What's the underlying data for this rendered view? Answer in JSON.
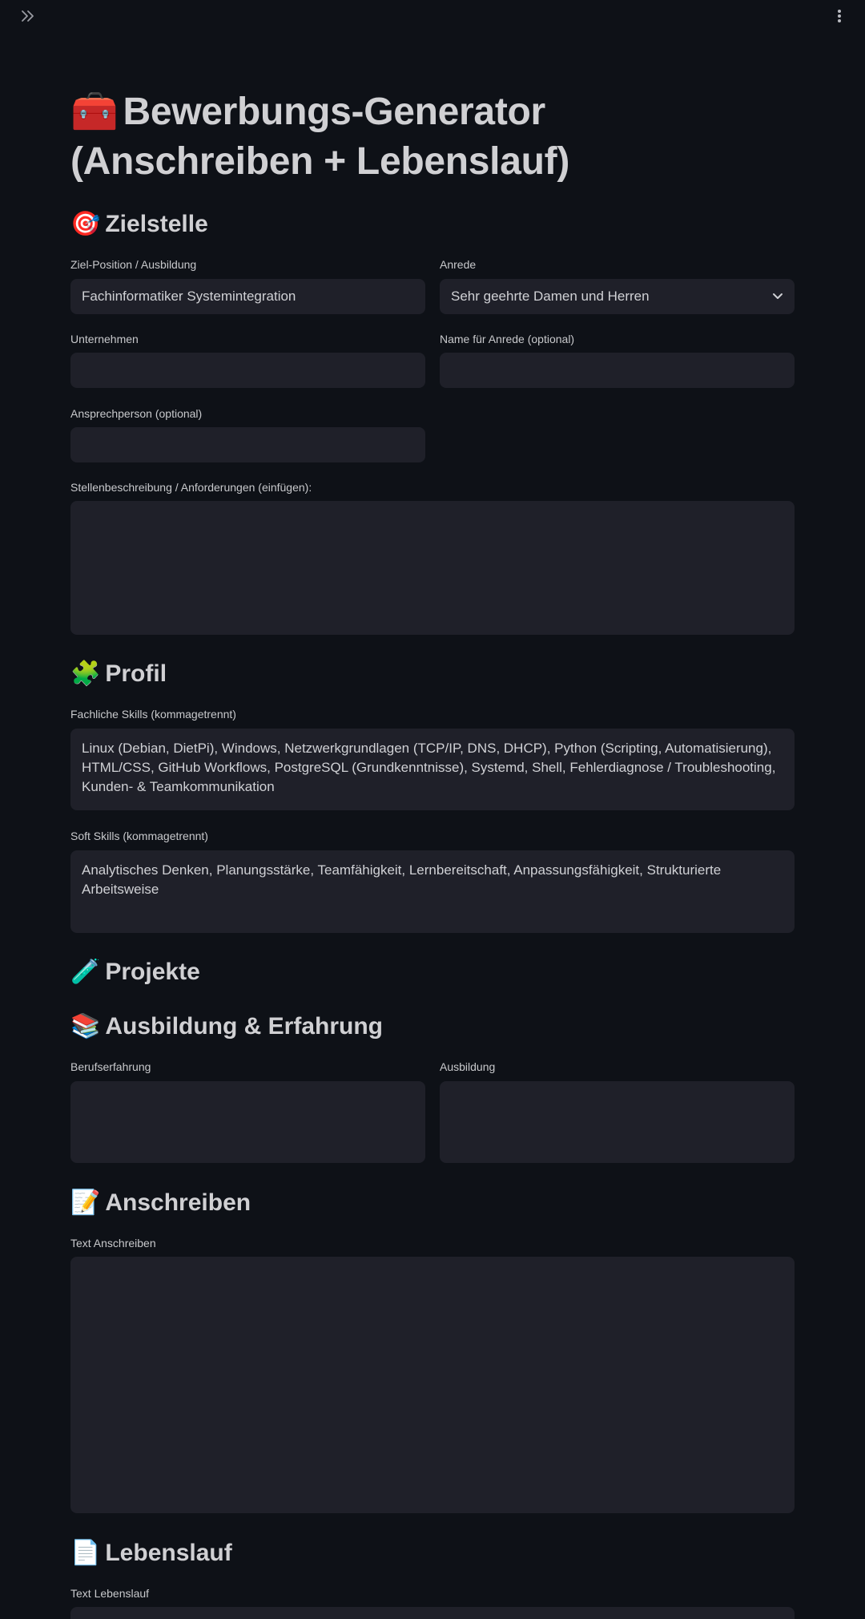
{
  "header": {
    "expand_icon": "double-chevron-right-icon",
    "menu_icon": "vertical-dots-icon"
  },
  "title": {
    "emoji": "🧰",
    "text": "Bewerbungs-Generator (Anschreiben + Lebenslauf)"
  },
  "sections": {
    "zielstelle": {
      "emoji": "🎯",
      "label": "Zielstelle"
    },
    "profil": {
      "emoji": "🧩",
      "label": "Profil"
    },
    "projekte": {
      "emoji": "🧪",
      "label": "Projekte"
    },
    "ausbildung": {
      "emoji": "📚",
      "label": "Ausbildung & Erfahrung"
    },
    "anschreiben": {
      "emoji": "📝",
      "label": "Anschreiben"
    },
    "lebenslauf": {
      "emoji": "📄",
      "label": "Lebenslauf"
    }
  },
  "fields": {
    "position": {
      "label": "Ziel-Position / Ausbildung",
      "value": "Fachinformatiker Systemintegration"
    },
    "anrede": {
      "label": "Anrede",
      "value": "Sehr geehrte Damen und Herren"
    },
    "unternehmen": {
      "label": "Unternehmen",
      "value": ""
    },
    "anrede_name": {
      "label": "Name für Anrede (optional)",
      "value": ""
    },
    "ansprechperson": {
      "label": "Ansprechperson (optional)",
      "value": ""
    },
    "stellenbeschreibung": {
      "label": "Stellenbeschreibung / Anforderungen (einfügen):",
      "value": ""
    },
    "fachliche_skills": {
      "label": "Fachliche Skills (kommagetrennt)",
      "value": "Linux (Debian, DietPi), Windows, Netzwerkgrundlagen (TCP/IP, DNS, DHCP), Python (Scripting, Automatisierung), HTML/CSS, GitHub Workflows, PostgreSQL (Grundkenntnisse), Systemd, Shell, Fehlerdiagnose / Troubleshooting, Kunden- & Teamkommunikation"
    },
    "soft_skills": {
      "label": "Soft Skills (kommagetrennt)",
      "value": "Analytisches Denken, Planungsstärke, Teamfähigkeit, Lernbereitschaft, Anpassungsfähigkeit, Strukturierte Arbeitsweise"
    },
    "berufserfahrung": {
      "label": "Berufserfahrung",
      "value": ""
    },
    "ausbildung": {
      "label": "Ausbildung",
      "value": ""
    },
    "text_anschreiben": {
      "label": "Text Anschreiben",
      "value": ""
    },
    "text_lebenslauf": {
      "label": "Text Lebenslauf",
      "value": ""
    }
  }
}
